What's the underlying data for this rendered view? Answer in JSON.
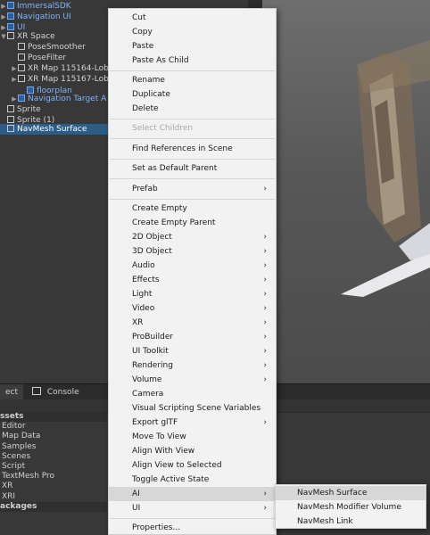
{
  "hierarchy": {
    "rows": [
      {
        "label": "ImmersalSDK",
        "prefab": true,
        "arrow": "▶"
      },
      {
        "label": "Navigation UI",
        "prefab": true,
        "arrow": "▶"
      },
      {
        "label": "UI",
        "prefab": true,
        "arrow": "▶"
      },
      {
        "label": "XR Space",
        "prefab": false,
        "arrow": "▼"
      },
      {
        "label": "PoseSmoother",
        "prefab": false,
        "arrow": ""
      },
      {
        "label": "PoseFilter",
        "prefab": false,
        "arrow": ""
      },
      {
        "label": "XR Map 115164-Loby",
        "prefab": false,
        "arrow": "▶"
      },
      {
        "label": "XR Map 115167-Loby",
        "prefab": false,
        "arrow": "▶"
      },
      {
        "label": "floorplan",
        "prefab": true,
        "arrow": ""
      },
      {
        "label": "Navigation Target A",
        "prefab": true,
        "arrow": "▶"
      },
      {
        "label": "Sprite",
        "prefab": false,
        "arrow": ""
      },
      {
        "label": "Sprite (1)",
        "prefab": false,
        "arrow": ""
      },
      {
        "label": "NavMesh Surface",
        "prefab": false,
        "arrow": "",
        "selected": true
      }
    ]
  },
  "bottom_tabs": {
    "project_label": "ect",
    "console_label": "Console"
  },
  "project": {
    "rows": [
      {
        "label": "ssets",
        "section": true
      },
      {
        "label": "Editor"
      },
      {
        "label": "Map Data"
      },
      {
        "label": "Samples"
      },
      {
        "label": "Scenes"
      },
      {
        "label": "Script"
      },
      {
        "label": "TextMesh Pro"
      },
      {
        "label": "XR"
      },
      {
        "label": "XRI"
      },
      {
        "label": "ackages",
        "section": true
      }
    ]
  },
  "context_menu": {
    "items": [
      {
        "label": "Cut"
      },
      {
        "label": "Copy"
      },
      {
        "label": "Paste"
      },
      {
        "label": "Paste As Child",
        "sep_after": true
      },
      {
        "label": "Rename"
      },
      {
        "label": "Duplicate"
      },
      {
        "label": "Delete",
        "sep_after": true
      },
      {
        "label": "Select Children",
        "disabled": true,
        "sep_after": true
      },
      {
        "label": "Find References in Scene",
        "sep_after": true
      },
      {
        "label": "Set as Default Parent",
        "sep_after": true
      },
      {
        "label": "Prefab",
        "submenu": true,
        "sep_after": true
      },
      {
        "label": "Create Empty"
      },
      {
        "label": "Create Empty Parent"
      },
      {
        "label": "2D Object",
        "submenu": true
      },
      {
        "label": "3D Object",
        "submenu": true
      },
      {
        "label": "Audio",
        "submenu": true
      },
      {
        "label": "Effects",
        "submenu": true
      },
      {
        "label": "Light",
        "submenu": true
      },
      {
        "label": "Video",
        "submenu": true
      },
      {
        "label": "XR",
        "submenu": true
      },
      {
        "label": "ProBuilder",
        "submenu": true
      },
      {
        "label": "UI Toolkit",
        "submenu": true
      },
      {
        "label": "Rendering",
        "submenu": true
      },
      {
        "label": "Volume",
        "submenu": true
      },
      {
        "label": "Camera"
      },
      {
        "label": "Visual Scripting Scene Variables"
      },
      {
        "label": "Export glTF",
        "submenu": true
      },
      {
        "label": "Move To View"
      },
      {
        "label": "Align With View"
      },
      {
        "label": "Align View to Selected"
      },
      {
        "label": "Toggle Active State"
      },
      {
        "label": "AI",
        "submenu": true,
        "hover": true
      },
      {
        "label": "UI",
        "submenu": true,
        "sep_after": true
      },
      {
        "label": "Properties..."
      }
    ]
  },
  "ai_submenu": {
    "items": [
      {
        "label": "NavMesh Surface",
        "hover": true
      },
      {
        "label": "NavMesh Modifier Volume"
      },
      {
        "label": "NavMesh Link"
      }
    ]
  },
  "colors": {
    "selection": "#2c5d87",
    "prefab_text": "#7fb4ff",
    "menu_bg": "#f2f2f2",
    "menu_hover": "#d7d7d7"
  }
}
